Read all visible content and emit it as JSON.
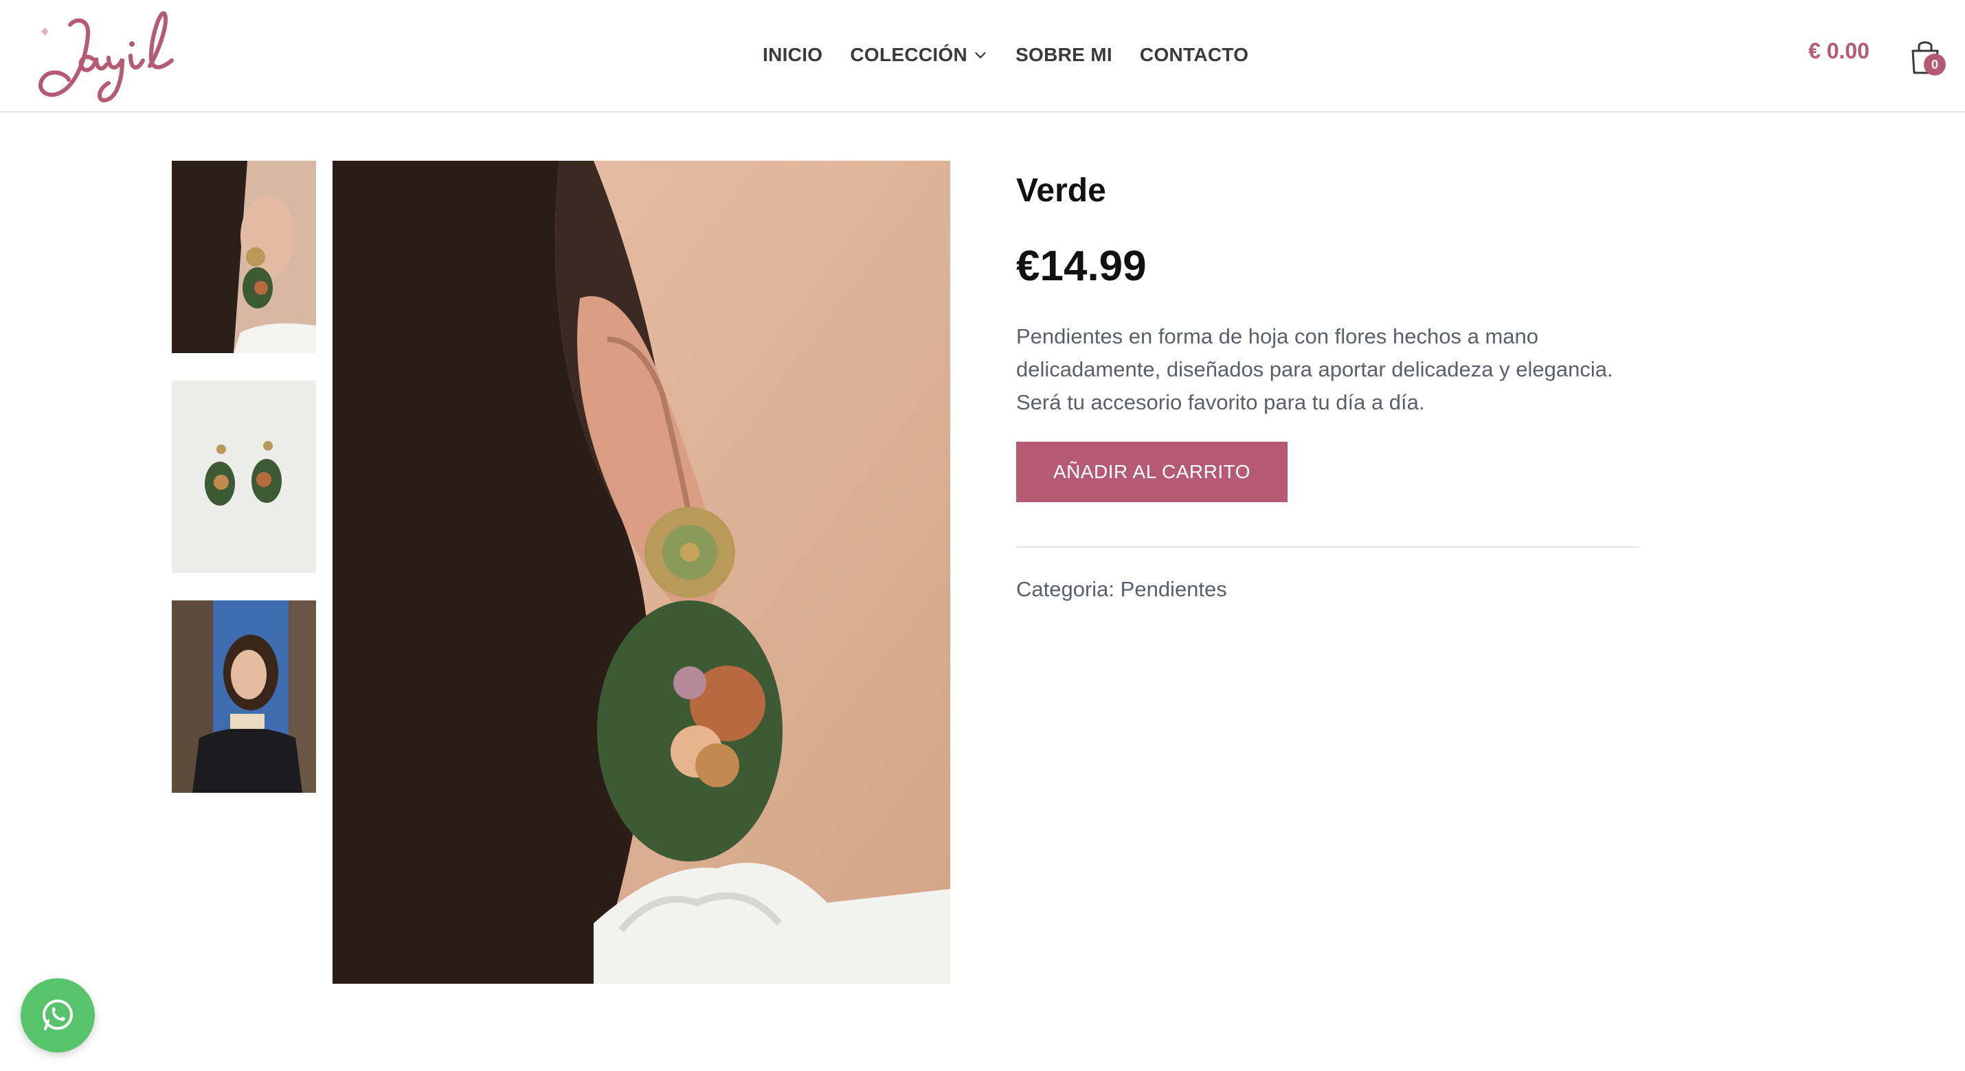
{
  "brand": {
    "logo_text": "Jayil",
    "accent_color": "#b65a74"
  },
  "nav": {
    "items": [
      {
        "label": "INICIO"
      },
      {
        "label": "COLECCIÓN",
        "has_dropdown": true
      },
      {
        "label": "SOBRE MI"
      },
      {
        "label": "CONTACTO"
      }
    ]
  },
  "cart": {
    "total": "€ 0.00",
    "count": "0",
    "icon": "shopping-bag-icon"
  },
  "gallery": {
    "thumbnails": [
      {
        "alt": "thumbnail-1"
      },
      {
        "alt": "thumbnail-2"
      },
      {
        "alt": "thumbnail-3"
      }
    ]
  },
  "product": {
    "title": "Verde",
    "price": "€14.99",
    "description": "Pendientes en forma de hoja con flores hechos a mano delicadamente, diseñados para aportar delicadeza y elegancia. Será tu accesorio favorito para tu día a día.",
    "add_to_cart_label": "AÑADIR AL CARRITO",
    "category_label": "Categoria:",
    "category_value": "Pendientes"
  },
  "whatsapp": {
    "icon": "whatsapp-icon",
    "color": "#57c46b"
  }
}
